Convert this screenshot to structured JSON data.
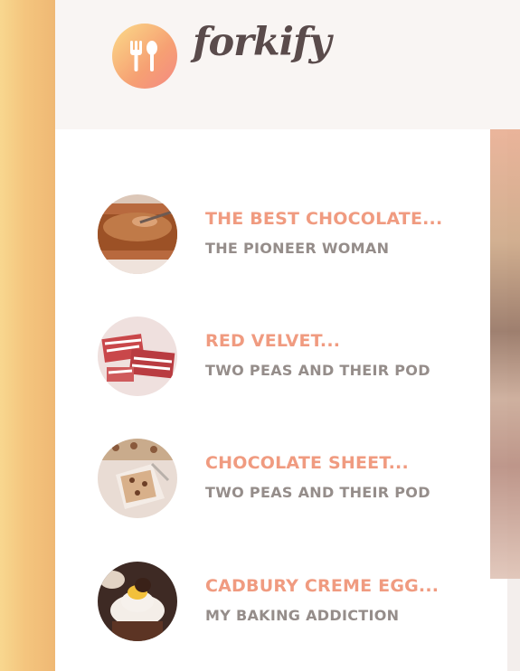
{
  "app": {
    "logo_text": "forkify",
    "logo_icon": "fork-spoon-icon"
  },
  "results": [
    {
      "title": "THE BEST CHOCOLATE...",
      "publisher": "THE PIONEER WOMAN",
      "thumb": "chocolate-cake"
    },
    {
      "title": "RED VELVET...",
      "publisher": "TWO PEAS AND THEIR POD",
      "thumb": "red-velvet"
    },
    {
      "title": "CHOCOLATE SHEET...",
      "publisher": "TWO PEAS AND THEIR POD",
      "thumb": "sheet-cake"
    },
    {
      "title": "CADBURY CREME EGG...",
      "publisher": "MY BAKING ADDICTION",
      "thumb": "cupcake"
    }
  ],
  "colors": {
    "title": "#f09b80",
    "publisher": "#958d8a",
    "logo_text": "#5a4b4b",
    "gradient_start": "#fbdb89",
    "gradient_end": "#f48982"
  }
}
